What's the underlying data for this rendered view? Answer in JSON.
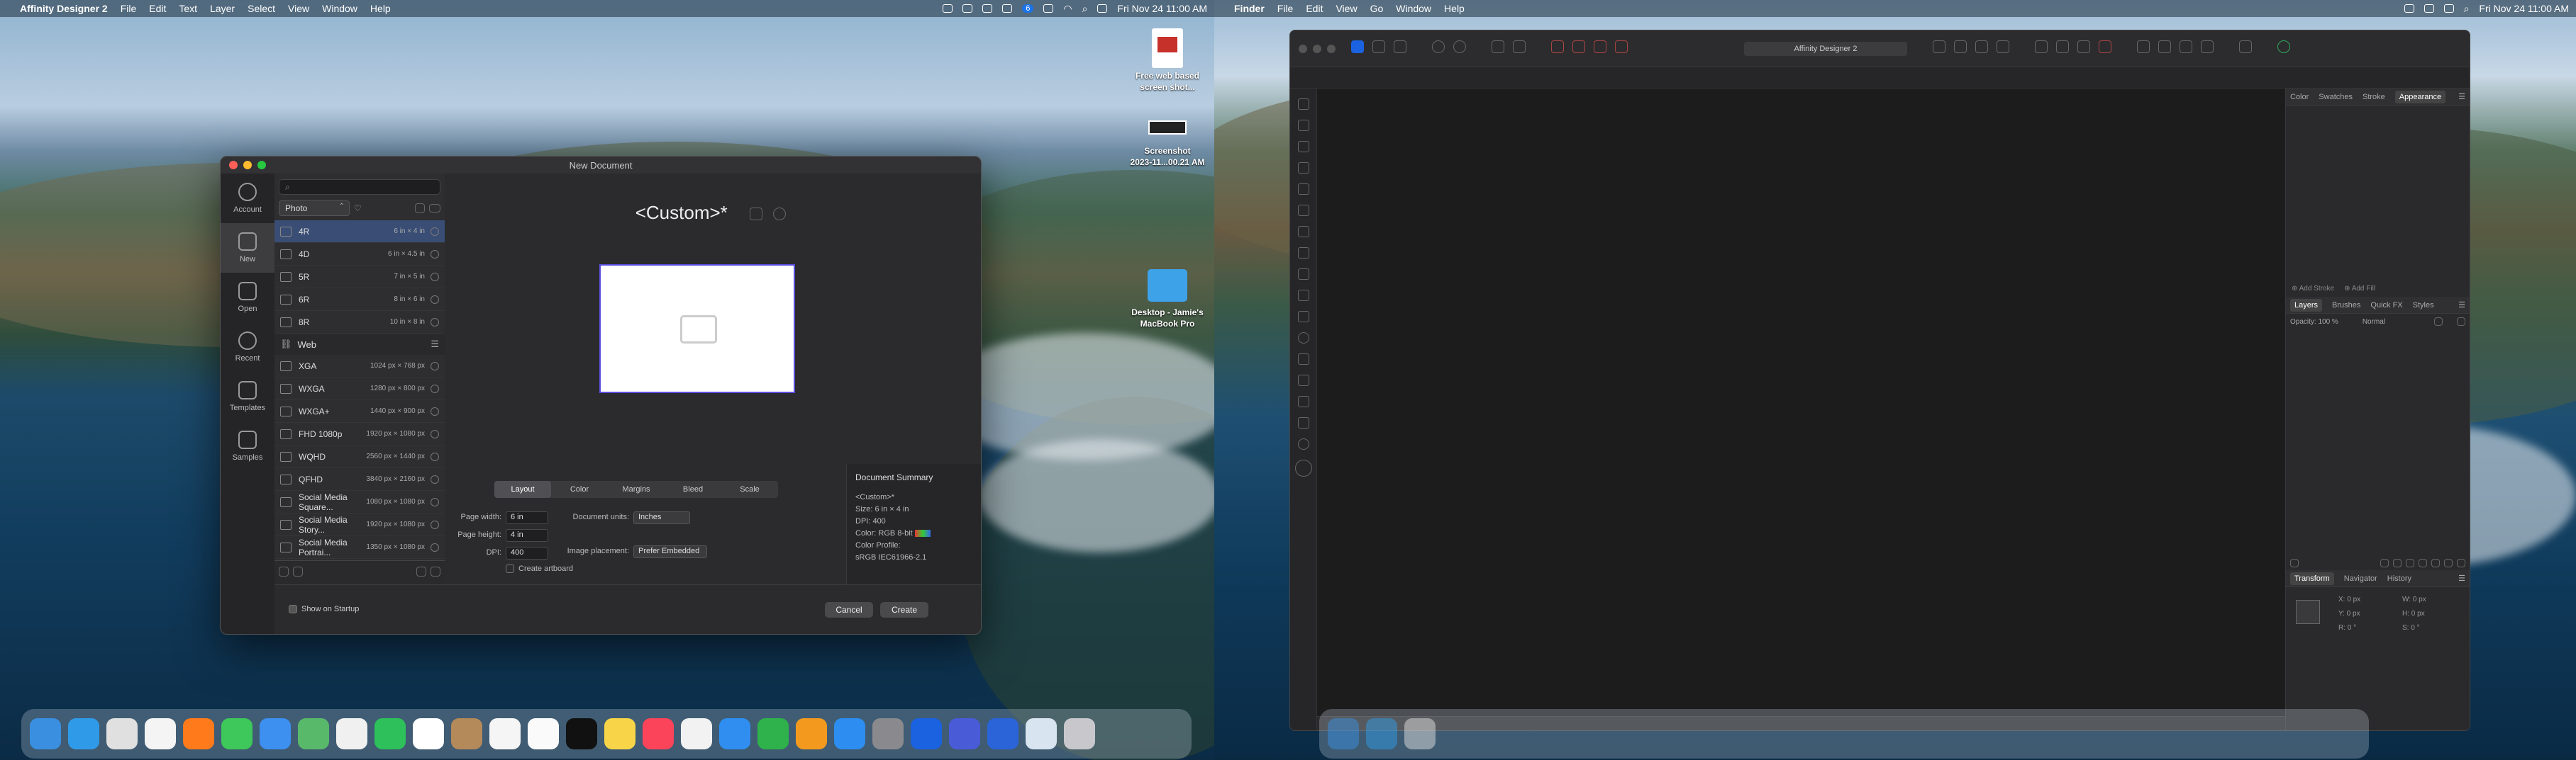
{
  "left_menubar": {
    "app": "Affinity Designer 2",
    "items": [
      "File",
      "Edit",
      "Text",
      "Layer",
      "Select",
      "View",
      "Window",
      "Help"
    ],
    "clock": "Fri Nov 24  11:00 AM",
    "badge": "6"
  },
  "right_menubar": {
    "app": "Finder",
    "items": [
      "File",
      "Edit",
      "View",
      "Go",
      "Window",
      "Help"
    ],
    "clock": "Fri Nov 24  11:00 AM"
  },
  "dialog": {
    "title": "New Document",
    "sidebar": [
      {
        "label": "Account",
        "icon": "account-icon"
      },
      {
        "label": "New",
        "icon": "new-document-icon"
      },
      {
        "label": "Open",
        "icon": "folder-icon"
      },
      {
        "label": "Recent",
        "icon": "clock-icon"
      },
      {
        "label": "Templates",
        "icon": "templates-icon"
      },
      {
        "label": "Samples",
        "icon": "samples-icon"
      }
    ],
    "category": "Photo",
    "presets_photo": [
      {
        "name": "4R",
        "size": "6 in × 4 in"
      },
      {
        "name": "4D",
        "size": "6 in × 4.5 in"
      },
      {
        "name": "5R",
        "size": "7 in × 5 in"
      },
      {
        "name": "6R",
        "size": "8 in × 6 in"
      },
      {
        "name": "8R",
        "size": "10 in × 8 in"
      }
    ],
    "group_web": "Web",
    "presets_web": [
      {
        "name": "XGA",
        "size": "1024 px × 768 px"
      },
      {
        "name": "WXGA",
        "size": "1280 px × 800 px"
      },
      {
        "name": "WXGA+",
        "size": "1440 px × 900 px"
      },
      {
        "name": "FHD 1080p",
        "size": "1920 px × 1080 px"
      },
      {
        "name": "WQHD",
        "size": "2560 px × 1440 px"
      },
      {
        "name": "QFHD",
        "size": "3840 px × 2160 px"
      },
      {
        "name": "Social Media Square...",
        "size": "1080 px × 1080 px"
      },
      {
        "name": "Social Media Story...",
        "size": "1920 px × 1080 px"
      },
      {
        "name": "Social Media Portrai...",
        "size": "1350 px × 1080 px"
      }
    ],
    "preset_title": "<Custom>*",
    "tabs": [
      "Layout",
      "Color",
      "Margins",
      "Bleed",
      "Scale"
    ],
    "page_width_label": "Page width:",
    "page_width": "6 in",
    "page_height_label": "Page height:",
    "page_height": "4 in",
    "dpi_label": "DPI:",
    "dpi": "400",
    "create_artboard": "Create artboard",
    "doc_units_label": "Document units:",
    "doc_units": "Inches",
    "image_placement_label": "Image placement:",
    "image_placement": "Prefer Embedded",
    "summary": {
      "heading": "Document Summary",
      "name": "<Custom>*",
      "size": "Size: 6 in × 4 in",
      "dpi": "DPI:  400",
      "color": "Color: RGB 8-bit",
      "profile_label": "Color Profile:",
      "profile": "sRGB IEC61966-2.1"
    },
    "show_on_startup": "Show on Startup",
    "cancel": "Cancel",
    "create": "Create"
  },
  "desktop": {
    "file1": "Free web based\nscreen shot...",
    "file2_name": "Screenshot\n2023-11...00.21 AM",
    "folder_name": "Desktop - Jamie's\nMacBook Pro"
  },
  "affinity_window": {
    "title": "Affinity Designer 2",
    "top_tabs": [
      "Color",
      "Swatches",
      "Stroke",
      "Appearance"
    ],
    "add_stroke": "Add Stroke",
    "add_fill": "Add Fill",
    "mid_tabs": [
      "Layers",
      "Brushes",
      "Quick FX",
      "Styles"
    ],
    "opacity": "Opacity:  100 %",
    "blend": "Normal",
    "bottom_tabs": [
      "Transform",
      "Navigator",
      "History"
    ],
    "transform": {
      "x": "X:  0 px",
      "y": "Y:  0 px",
      "w": "W:  0 px",
      "h": "H:  0 px",
      "r": "R:  0 °",
      "s": "S:  0 °"
    }
  },
  "colors": {
    "accent": "#3a4e75",
    "preview_border": "#5a4ee0",
    "selection": "#1a73e8"
  }
}
